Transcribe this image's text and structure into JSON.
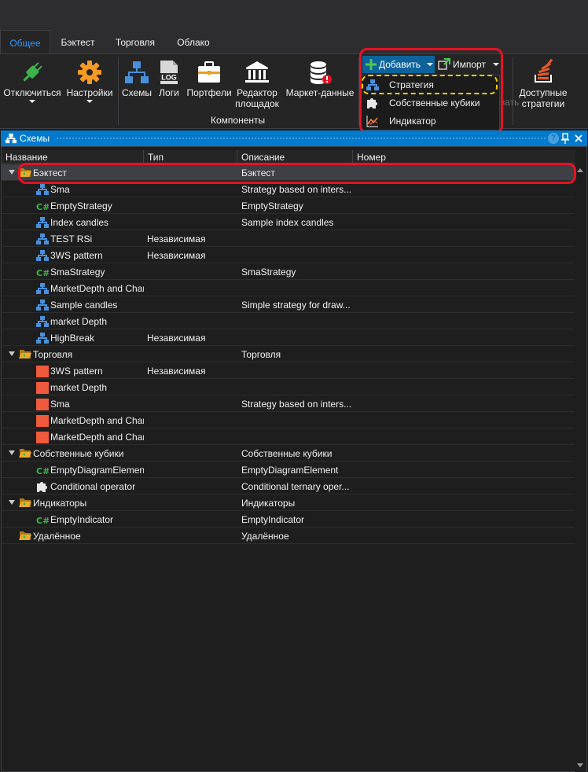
{
  "tabs": [
    "Общее",
    "Бэктест",
    "Торговля",
    "Облако"
  ],
  "ribbon": {
    "disconnect": "Отключиться",
    "settings": "Настройки",
    "schemas": "Схемы",
    "logs": "Логи",
    "portfolios": "Портфели",
    "editor_line1": "Редактор",
    "editor_line2": "площадок",
    "market_data": "Маркет-данные",
    "group_components": "Компоненты",
    "add": "Добавить",
    "import": "Импорт",
    "hidden_fragment": "вать",
    "available_line1": "Доступные",
    "available_line2": "стратегии",
    "log_icon_text": "LOG"
  },
  "dropdown": [
    "Стратегия",
    "Собственные кубики",
    "Индикатор"
  ],
  "panel": {
    "title": "Схемы"
  },
  "columns": [
    "Название",
    "Тип",
    "Описание",
    "Номер"
  ],
  "rows": [
    {
      "name": "Бэктест",
      "type": "",
      "desc": "Бэктест",
      "level": 0,
      "icon": "folder",
      "expanded": true
    },
    {
      "name": "Sma",
      "type": "",
      "desc": "Strategy based on inters...",
      "level": 1,
      "icon": "schema"
    },
    {
      "name": "EmptyStrategy",
      "type": "",
      "desc": "EmptyStrategy",
      "level": 1,
      "icon": "csharp"
    },
    {
      "name": "Index candles",
      "type": "",
      "desc": "Sample index candles",
      "level": 1,
      "icon": "schema"
    },
    {
      "name": "TEST RSi",
      "type": "Независимая",
      "desc": "",
      "level": 1,
      "icon": "schema"
    },
    {
      "name": "3WS pattern",
      "type": "Независимая",
      "desc": "",
      "level": 1,
      "icon": "schema"
    },
    {
      "name": "SmaStrategy",
      "type": "",
      "desc": "SmaStrategy",
      "level": 1,
      "icon": "csharp"
    },
    {
      "name": "MarketDepth and Chart",
      "type": "",
      "desc": "",
      "level": 1,
      "icon": "schema"
    },
    {
      "name": "Sample candles",
      "type": "",
      "desc": "Simple strategy for draw...",
      "level": 1,
      "icon": "schema"
    },
    {
      "name": "market Depth",
      "type": "",
      "desc": "",
      "level": 1,
      "icon": "schema"
    },
    {
      "name": "HighBreak",
      "type": "Независимая",
      "desc": "",
      "level": 1,
      "icon": "schema"
    },
    {
      "name": "Торговля",
      "type": "",
      "desc": "Торговля",
      "level": 0,
      "icon": "folder",
      "expanded": true
    },
    {
      "name": "3WS pattern",
      "type": "Независимая",
      "desc": "",
      "level": 1,
      "icon": "orange"
    },
    {
      "name": "market Depth",
      "type": "",
      "desc": "",
      "level": 1,
      "icon": "orange"
    },
    {
      "name": "Sma",
      "type": "",
      "desc": "Strategy based on inters...",
      "level": 1,
      "icon": "orange"
    },
    {
      "name": "MarketDepth and Chart",
      "type": "",
      "desc": "",
      "level": 1,
      "icon": "orange"
    },
    {
      "name": "MarketDepth and Chart",
      "type": "",
      "desc": "",
      "level": 1,
      "icon": "orange"
    },
    {
      "name": "Собственные кубики",
      "type": "",
      "desc": "Собственные кубики",
      "level": 0,
      "icon": "folder",
      "expanded": true
    },
    {
      "name": "EmptyDiagramElement",
      "type": "",
      "desc": "EmptyDiagramElement",
      "level": 1,
      "icon": "csharp"
    },
    {
      "name": "Conditional operator",
      "type": "",
      "desc": "Conditional ternary oper...",
      "level": 1,
      "icon": "puzzle"
    },
    {
      "name": "Индикаторы",
      "type": "",
      "desc": "Индикаторы",
      "level": 0,
      "icon": "folder",
      "expanded": true
    },
    {
      "name": "EmptyIndicator",
      "type": "",
      "desc": "EmptyIndicator",
      "level": 1,
      "icon": "csharp"
    },
    {
      "name": "Удалённое",
      "type": "",
      "desc": "Удалённое",
      "level": 0,
      "icon": "folder",
      "expanded": false
    }
  ],
  "colors": {
    "accent": "#007acc",
    "highlight_red": "#e81123",
    "highlight_yellow": "#f5d000",
    "folder": "#e0a526",
    "schema": "#4a90d9",
    "csharp": "#3cb44b",
    "orange": "#f05a3c"
  }
}
